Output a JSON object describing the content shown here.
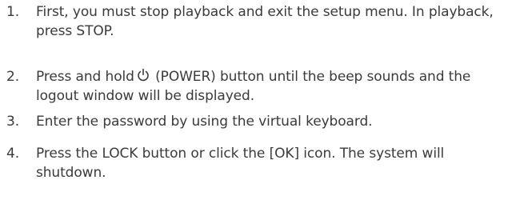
{
  "steps": [
    {
      "number": "1.",
      "text": "First, you must stop playback and exit the setup menu. In playback, press STOP."
    },
    {
      "number": "2.",
      "text_before_icon": "Press and hold",
      "icon": "power-icon",
      "text_after_icon": " (POWER) button until the beep sounds and the logout window will be displayed."
    },
    {
      "number": "3.",
      "text": "Enter the password by using the virtual keyboard."
    },
    {
      "number": "4.",
      "text": "Press the LOCK button or click the [OK] icon. The system will shutdown."
    }
  ]
}
